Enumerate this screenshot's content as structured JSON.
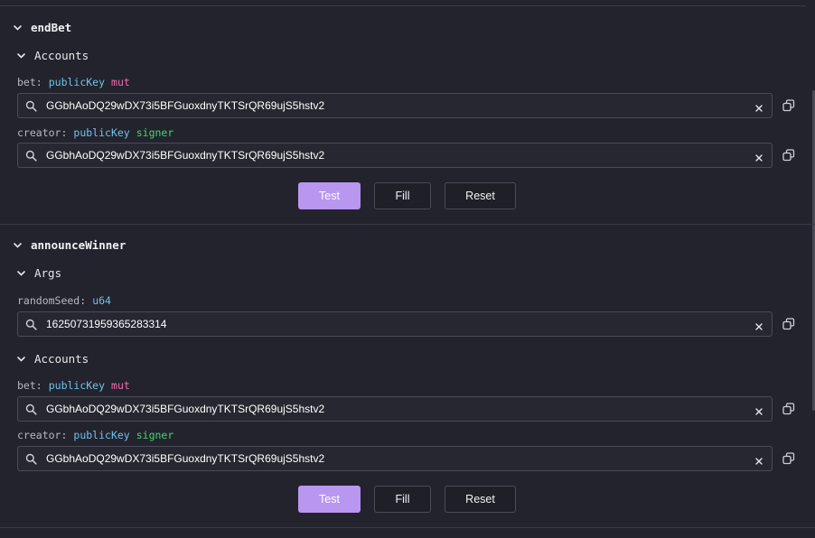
{
  "instructions": [
    {
      "name": "endBet",
      "accounts_header": "Accounts",
      "accounts": [
        {
          "name": "bet",
          "type": "publicKey",
          "flag": "mut",
          "value": "GGbhAoDQ29wDX73i5BFGuoxdnyTKTSrQR69ujS5hstv2"
        },
        {
          "name": "creator",
          "type": "publicKey",
          "flag": "signer",
          "value": "GGbhAoDQ29wDX73i5BFGuoxdnyTKTSrQR69ujS5hstv2"
        }
      ],
      "buttons": {
        "test": "Test",
        "fill": "Fill",
        "reset": "Reset"
      }
    },
    {
      "name": "announceWinner",
      "args_header": "Args",
      "args": [
        {
          "name": "randomSeed",
          "type": "u64",
          "value": "16250731959365283314"
        }
      ],
      "accounts_header": "Accounts",
      "accounts": [
        {
          "name": "bet",
          "type": "publicKey",
          "flag": "mut",
          "value": "GGbhAoDQ29wDX73i5BFGuoxdnyTKTSrQR69ujS5hstv2"
        },
        {
          "name": "creator",
          "type": "publicKey",
          "flag": "signer",
          "value": "GGbhAoDQ29wDX73i5BFGuoxdnyTKTSrQR69ujS5hstv2"
        }
      ],
      "buttons": {
        "test": "Test",
        "fill": "Fill",
        "reset": "Reset"
      }
    }
  ],
  "colors": {
    "background": "#23232d",
    "type": "#6ec3ea",
    "mut": "#ee6db0",
    "signer": "#42d66e",
    "test_button": "#b996f0"
  },
  "icons": [
    "chevron-down-icon",
    "search-icon",
    "clear-icon",
    "copy-icon"
  ]
}
